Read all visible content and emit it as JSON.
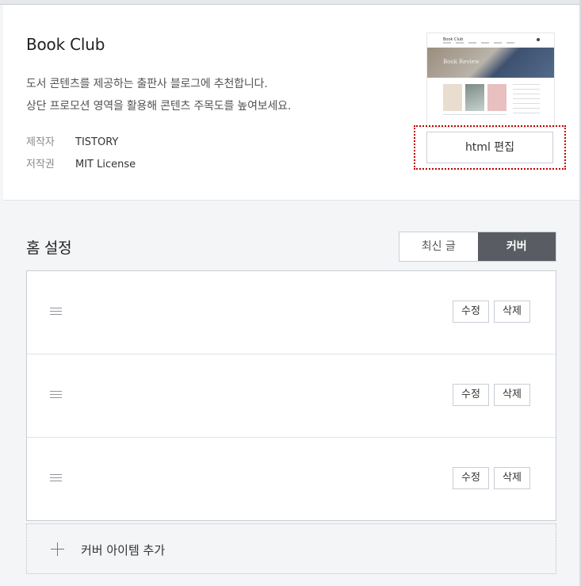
{
  "theme": {
    "title": "Book Club",
    "description_line1": "도서 콘텐츠를 제공하는 출판사 블로그에 추천합니다.",
    "description_line2": "상단 프로모션 영역을 활용해 콘텐츠 주목도를 높여보세요.",
    "author_label": "제작자",
    "author_value": "TISTORY",
    "license_label": "저작권",
    "license_value": "MIT License",
    "preview": {
      "logo": "Book Club",
      "hero_text": "Book Review"
    },
    "html_edit_label": "html 편집"
  },
  "home": {
    "title": "홈 설정",
    "tabs": [
      {
        "label": "최신 글",
        "active": false
      },
      {
        "label": "커버",
        "active": true
      }
    ],
    "items": [
      {
        "edit_label": "수정",
        "delete_label": "삭제"
      },
      {
        "edit_label": "수정",
        "delete_label": "삭제"
      },
      {
        "edit_label": "수정",
        "delete_label": "삭제"
      }
    ],
    "add_label": "커버 아이템 추가"
  },
  "colors": {
    "focus_ring": "#c00000",
    "active_tab": "#595d63",
    "background": "#f4f5f7"
  }
}
